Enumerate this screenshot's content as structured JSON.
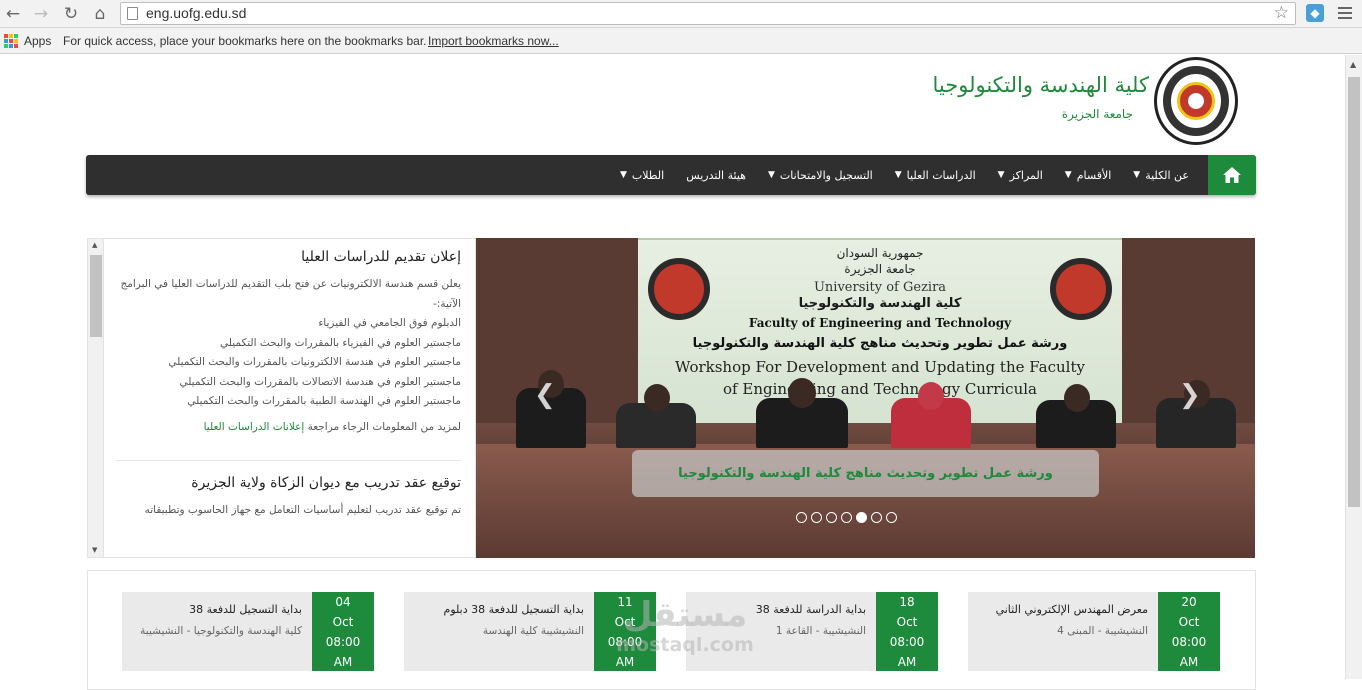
{
  "browser": {
    "url": "eng.uofg.edu.sd",
    "apps_label": "Apps",
    "bookmarks_hint": "For quick access, place your bookmarks here on the bookmarks bar.",
    "import_link": "Import bookmarks now..."
  },
  "header": {
    "title": "كلية الهندسة والتكنولوجيا",
    "subtitle": "جامعة الجزيرة"
  },
  "nav": {
    "items": [
      {
        "label": "عن الكلية",
        "has_dropdown": true
      },
      {
        "label": "الأقسام",
        "has_dropdown": true
      },
      {
        "label": "المراكز",
        "has_dropdown": true
      },
      {
        "label": "الدراسات العليا",
        "has_dropdown": true
      },
      {
        "label": "التسجيل والامتحانات",
        "has_dropdown": true
      },
      {
        "label": "هيئة التدريس",
        "has_dropdown": false
      },
      {
        "label": "الطلاب",
        "has_dropdown": true
      }
    ]
  },
  "news": {
    "title": "إعلان تقديم للدراسات العليا",
    "body": [
      "يعلن قسم هندسة الالكترونيات عن فتح بلب التقديم للدراسات العليا في البرامج الآتية:-",
      "الدبلوم فوق الجامعي في الفيزياء",
      "ماجستير العلوم في الفيزياء بالمقررات والبحث التكميلي",
      "ماجستير العلوم في هندسة الالكترونيات بالمقررات والبحث التكميلي",
      "ماجستير العلوم في هندسة الاتصالات بالمقررات والبحث التكميلي",
      "ماجستير العلوم في الهندسة الطبية بالمقررات والبحث التكميلي"
    ],
    "more_prefix": "لمزيد من المعلومات الرجاء مراجعة",
    "more_link": "إعلانات الدراسات العليا",
    "second_title": "توقيع عقد تدريب مع ديوان الزكاة ولاية الجزيرة",
    "second_body": "تم توقيع عقد تدريب لتعليم أساسيات التعامل مع جهاز الحاسوب وتطبيقاته"
  },
  "slider": {
    "banner_lines": [
      "جمهورية السودان",
      "جامعة الجزيرة",
      "University of Gezira",
      "كلية الهندسة والتكنولوجيا",
      "Faculty of Engineering and Technology",
      "ورشة عمل تطوير وتحديث مناهج كلية الهندسة والتكنولوجيا",
      "Workshop For Development and Updating the Faculty",
      "of Engineering and Technology Curricula"
    ],
    "caption": "ورشة عمل تطوير وتحديث مناهج كلية الهندسة والتكنولوجيا",
    "dots_count": 7,
    "active_dot": 4
  },
  "events": [
    {
      "title": "بداية التسجيل للدفعة 38",
      "location": "كلية الهندسة والتكنولوجيا - النشيشيبة",
      "day": "04",
      "month": "Oct",
      "time": "08:00",
      "ampm": "AM"
    },
    {
      "title": "بداية التسجيل للدفعة 38 دبلوم",
      "location": "النشيشيبة كلية الهندسة",
      "day": "11",
      "month": "Oct",
      "time": "08:00",
      "ampm": "AM"
    },
    {
      "title": "بداية الدراسة للدفعة 38",
      "location": "النشيشيبة - القاعة 1",
      "day": "18",
      "month": "Oct",
      "time": "08:00",
      "ampm": "AM"
    },
    {
      "title": "معرض المهندس الإلكتروني الثاني",
      "location": "النشيشيبة - المبنى 4",
      "day": "20",
      "month": "Oct",
      "time": "08:00",
      "ampm": "AM"
    }
  ],
  "watermark": {
    "arabic": "مستقل",
    "latin": "mostaql.com"
  },
  "colors": {
    "brand_green": "#1d8a3c",
    "nav_dark": "#2f2f2f"
  }
}
